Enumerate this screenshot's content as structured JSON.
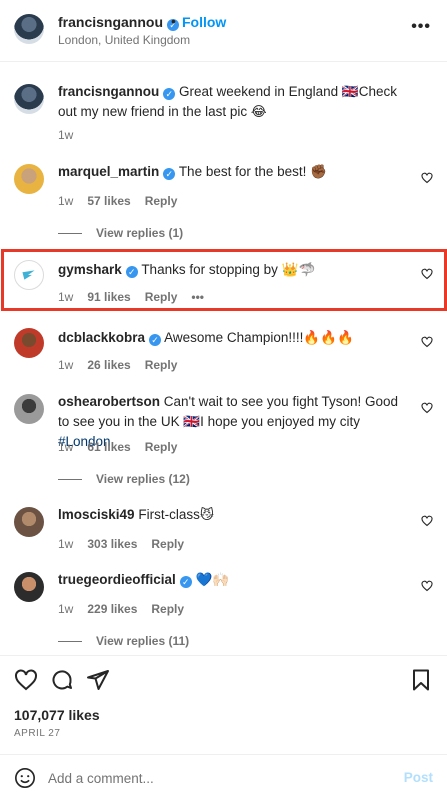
{
  "header": {
    "username": "francisngannou",
    "follow_label": "Follow",
    "location": "London, United Kingdom",
    "separator": "•"
  },
  "caption": {
    "username": "francisngannou",
    "text": "Great weekend in England 🇬🇧Check out my new friend in the last pic 😂",
    "time": "1w"
  },
  "comments": [
    {
      "username": "marquel_martin",
      "verified": true,
      "text": "The best for the best! ✊🏾",
      "time": "1w",
      "likes": "57 likes",
      "reply": "Reply",
      "view_replies": "View replies (1)"
    },
    {
      "username": "gymshark",
      "verified": true,
      "text": "Thanks for stopping by 👑🦈",
      "time": "1w",
      "likes": "91 likes",
      "reply": "Reply",
      "more": "•••"
    },
    {
      "username": "dcblackkobra",
      "verified": true,
      "text": "Awesome Champion!!!!🔥🔥🔥",
      "time": "1w",
      "likes": "26 likes",
      "reply": "Reply"
    },
    {
      "username": "oshearobertson",
      "verified": false,
      "text_before": "Can't wait to see you fight Tyson! Good to see you in the UK 🇬🇧I hope you enjoyed my city ",
      "hashtag": "#London",
      "time": "1w",
      "likes": "61 likes",
      "reply": "Reply",
      "view_replies": "View replies (12)"
    },
    {
      "username": "lmosciski49",
      "verified": false,
      "text": "First-class😼",
      "time": "1w",
      "likes": "303 likes",
      "reply": "Reply"
    },
    {
      "username": "truegeordieofficial",
      "verified": true,
      "text": "💙🙌🏻",
      "time": "1w",
      "likes": "229 likes",
      "reply": "Reply",
      "view_replies": "View replies (11)"
    }
  ],
  "post": {
    "likes": "107,077 likes",
    "date": "APRIL 27"
  },
  "add_comment": {
    "placeholder": "Add a comment...",
    "post_label": "Post"
  },
  "colors": {
    "accent": "#0095f6",
    "verified": "#3797f0",
    "highlight_border": "#e73828",
    "muted": "#737373"
  }
}
